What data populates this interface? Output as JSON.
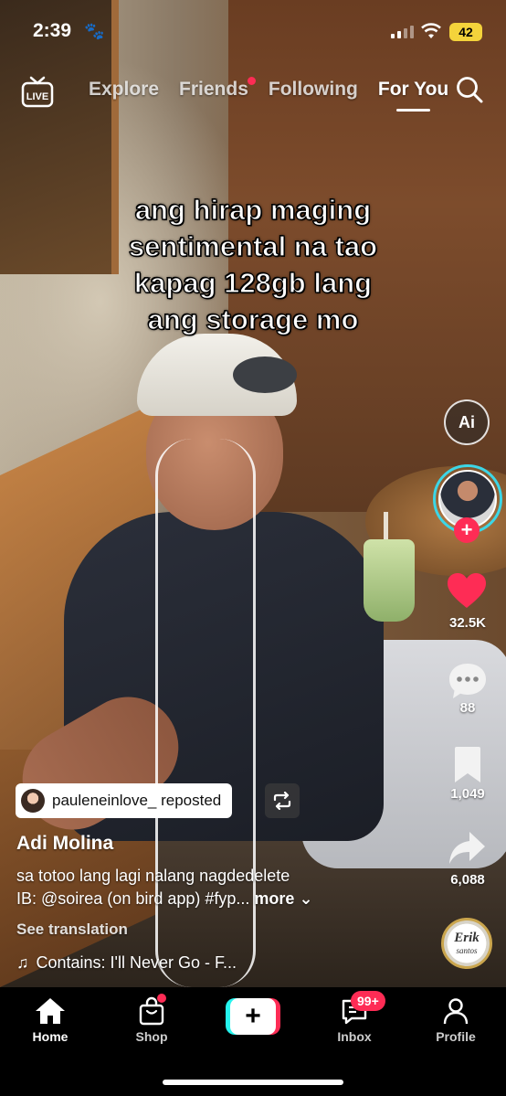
{
  "status_bar": {
    "time": "2:39",
    "battery": "42"
  },
  "top_nav": {
    "tabs": [
      {
        "label": "Explore",
        "active": false
      },
      {
        "label": "Friends",
        "active": false,
        "has_dot": true
      },
      {
        "label": "Following",
        "active": false
      },
      {
        "label": "For You",
        "active": true
      }
    ],
    "live_label": "LIVE"
  },
  "video": {
    "caption_lines": [
      "ang hirap maging",
      "sentimental na tao",
      "kapag 128gb lang",
      "ang storage mo"
    ]
  },
  "rail": {
    "ai_label": "Ai",
    "likes": "32.5K",
    "comments": "88",
    "saves": "1,049",
    "shares": "6,088",
    "disc_line1": "Erik",
    "disc_line2": "santos"
  },
  "post": {
    "repost_text": "pauleneinlove_ reposted",
    "author": "Adi Molina",
    "description_line1": "sa totoo lang lagi nalang nagdedelete",
    "description_line2": "IB: @soirea (on bird app) #fyp...",
    "more_label": "more",
    "translate_label": "See translation",
    "music": "Contains: I'll Never Go - F..."
  },
  "bottom_nav": {
    "items": [
      {
        "label": "Home",
        "active": true
      },
      {
        "label": "Shop",
        "active": false
      },
      {
        "label": "Inbox",
        "active": false,
        "badge": "99+"
      },
      {
        "label": "Profile",
        "active": false
      }
    ]
  },
  "colors": {
    "accent_red": "#fe2c55",
    "accent_cyan": "#25f4ee",
    "battery_yellow": "#f4d33b"
  }
}
